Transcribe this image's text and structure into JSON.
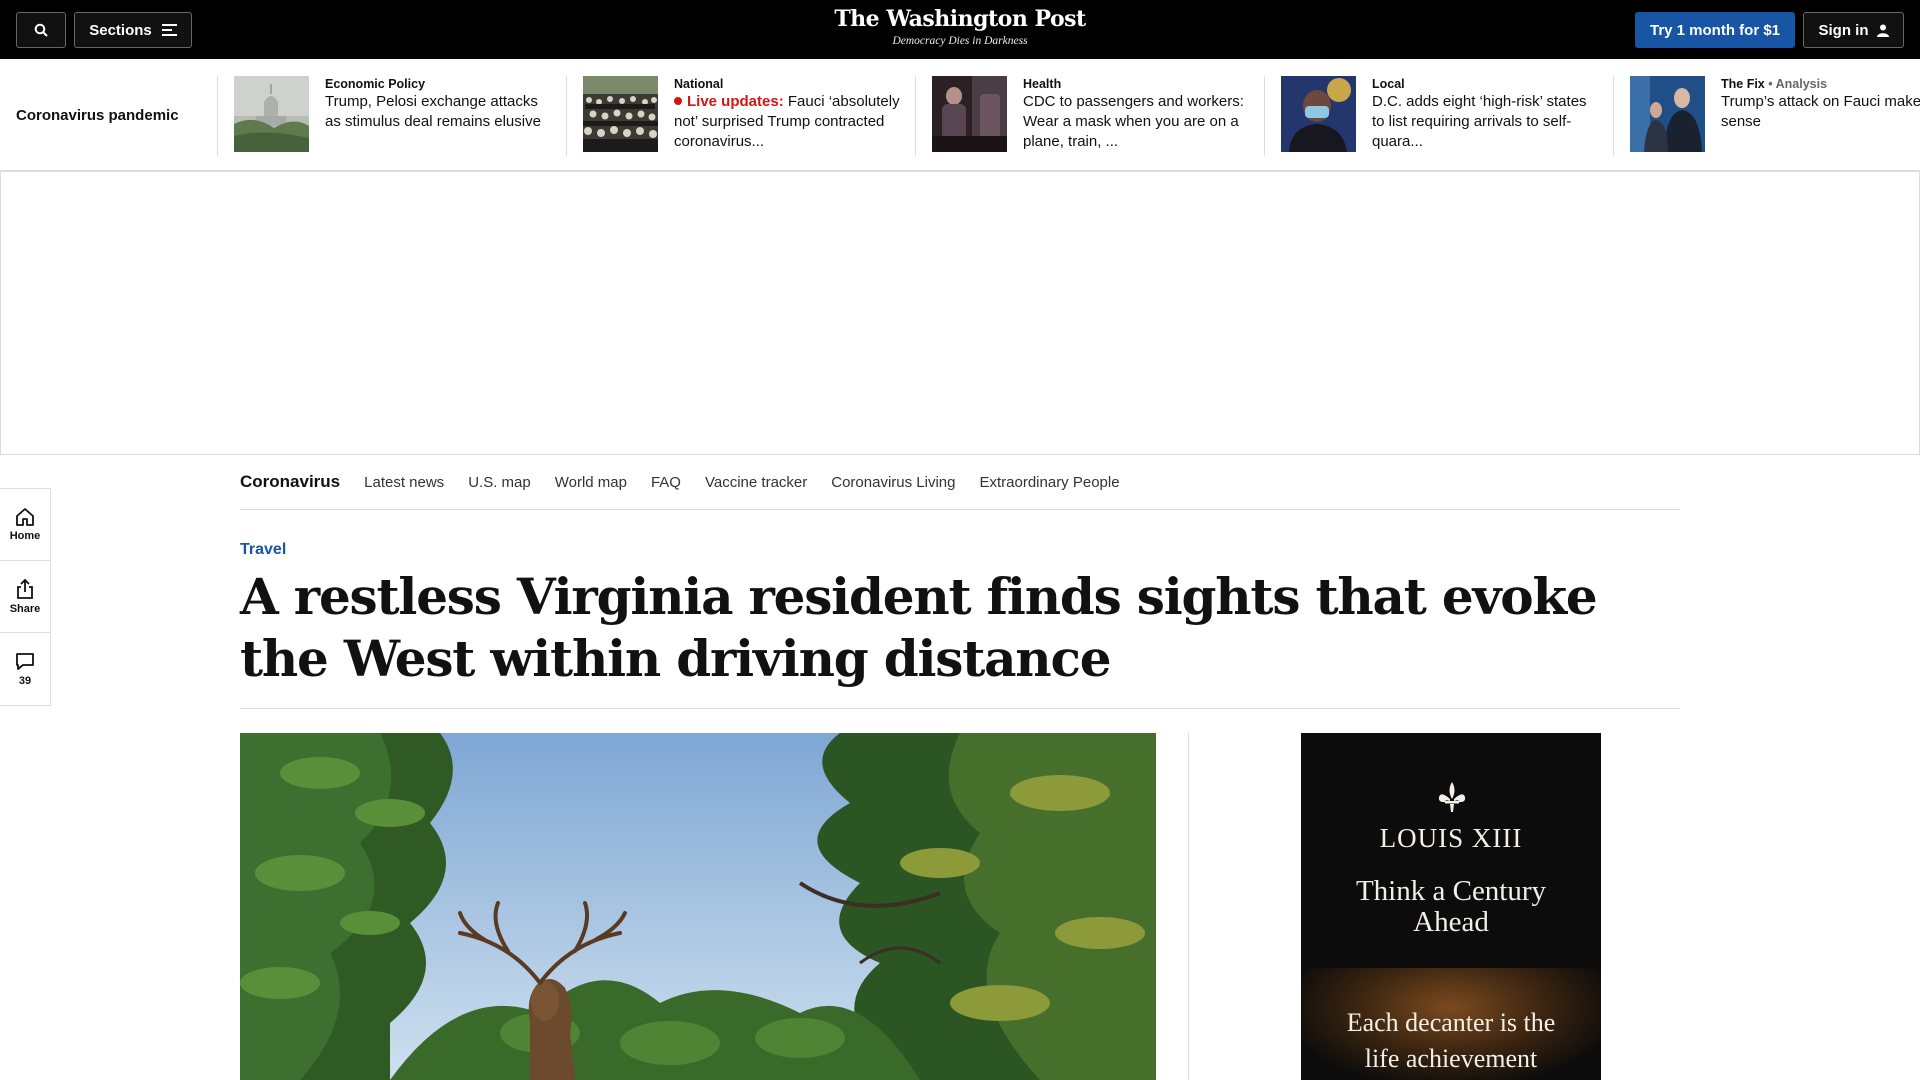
{
  "header": {
    "sections_label": "Sections",
    "logo_title": "The Washington Post",
    "logo_tagline": "Democracy Dies in Darkness",
    "subscribe_label": "Try 1 month for $1",
    "signin_label": "Sign in"
  },
  "strip": {
    "label": "Coronavirus pandemic",
    "items": [
      {
        "kicker": "Economic Policy",
        "headline": "Trump, Pelosi exchange attacks as stimulus deal remains elusive"
      },
      {
        "kicker": "National",
        "live": "Live updates:",
        "headline": "Fauci ‘absolutely not’ surprised Trump contracted coronavirus..."
      },
      {
        "kicker": "Health",
        "headline": "CDC to passengers and workers: Wear a mask when you are on a plane, train, ..."
      },
      {
        "kicker": "Local",
        "headline": "D.C. adds eight ‘high-risk’ states to list requiring arrivals to self-quara..."
      },
      {
        "kicker": "The Fix",
        "kicker_extra": "• Analysis",
        "headline": "Trump’s attack on Fauci makes no sense"
      }
    ]
  },
  "rail": {
    "home": "Home",
    "share": "Share",
    "comments": "39"
  },
  "subnav": {
    "primary": "Coronavirus",
    "links": [
      "Latest news",
      "U.S. map",
      "World map",
      "FAQ",
      "Vaccine tracker",
      "Coronavirus Living",
      "Extraordinary People"
    ]
  },
  "article": {
    "kicker": "Travel",
    "headline": "A restless Virginia resident finds sights that evoke the West within driving distance"
  },
  "ad": {
    "brand": "LOUIS XIII",
    "tagline": "Think a Century Ahead",
    "bottom": "Each decanter is the life achievement"
  },
  "colors": {
    "masthead": "#000000",
    "accent_blue": "#1955a5",
    "live_red": "#d01616"
  }
}
